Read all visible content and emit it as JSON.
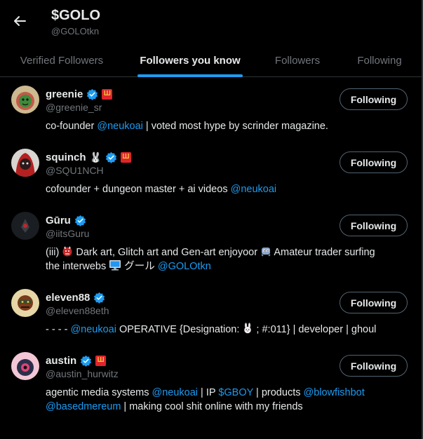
{
  "header": {
    "title": "$GOLO",
    "handle": "@GOLOtkn"
  },
  "tabs": [
    {
      "label": "Verified Followers",
      "active": false
    },
    {
      "label": "Followers you know",
      "active": true
    },
    {
      "label": "Followers",
      "active": false
    },
    {
      "label": "Following",
      "active": false
    }
  ],
  "colors": {
    "accent": "#1d9bf0",
    "background": "#000000",
    "muted": "#71767b",
    "flag_red": "#e0242a"
  },
  "users": [
    {
      "name": "greenie",
      "handle": "@greenie_sr",
      "button": "Following",
      "bio": [
        {
          "text": "co-founder "
        },
        {
          "link": "@neukoai"
        },
        {
          "text": " | voted most hype by scrinder magazine."
        }
      ]
    },
    {
      "name": "squinch",
      "name_emoji": "🐰",
      "handle": "@SQU1NCH",
      "button": "Following",
      "bio": [
        {
          "text": "cofounder + dungeon master + ai videos "
        },
        {
          "link": "@neukoai"
        }
      ]
    },
    {
      "name": "Gūru",
      "handle": "@iitsGuru",
      "button": "Following",
      "bio_line1": "(iii) ",
      "bio_line1b": " Dark art, Glitch art and Gen-art enjoyoor ",
      "bio_line1c": " Amateur trader surfing",
      "bio_line2": "the interwebs ",
      "bio_line2b": " グール ",
      "bio_link": "@GOLOtkn"
    },
    {
      "name": "eleven88",
      "handle": "@eleven88eth",
      "button": "Following",
      "bio_pre": "- - - - ",
      "bio_link": "@neukoai",
      "bio_mid": " OPERATIVE {Designation: ",
      "bio_post": " ; #:011} | developer | ghoul"
    },
    {
      "name": "austin",
      "handle": "@austin_hurwitz",
      "button": "Following",
      "bio_line1": [
        {
          "text": "agentic media systems "
        },
        {
          "link": "@neukoai"
        },
        {
          "text": " | IP "
        },
        {
          "link": "$GBOY"
        },
        {
          "text": " | products "
        },
        {
          "link": "@blowfishbot"
        }
      ],
      "bio_line2": [
        {
          "link": "@basedmereum"
        },
        {
          "text": " | making cool shit online with my friends"
        }
      ]
    }
  ]
}
